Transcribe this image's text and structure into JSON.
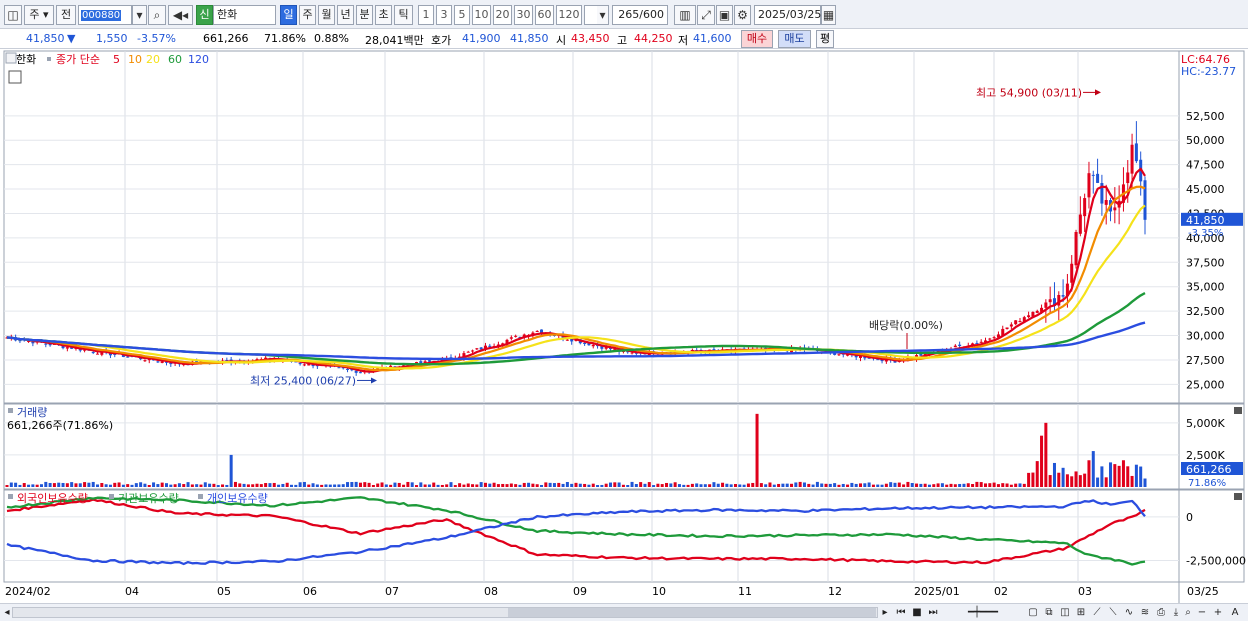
{
  "toolbar": {
    "market": "주",
    "market_alt": "전",
    "stock_code": "000880",
    "badge": "신",
    "stock_name": "한화",
    "periods": [
      "일",
      "주",
      "월",
      "년",
      "분",
      "초",
      "틱"
    ],
    "selected_period": "일",
    "intervals": [
      "1",
      "3",
      "5",
      "10",
      "20",
      "30",
      "60",
      "120"
    ],
    "count": "265",
    "count_total": "/600",
    "date": "2025/03/25"
  },
  "quote": {
    "price": "41,850",
    "direction": "▼",
    "change": "1,550",
    "change_pct": "-3.57%",
    "volume": "661,266",
    "volume_pct": "71.86%",
    "turnover_pct": "0.88%",
    "amount": "28,041백만",
    "ask_label": "호가",
    "ask1": "41,900",
    "ask2": "41,850",
    "open_label": "시",
    "open": "43,450",
    "high_label": "고",
    "high": "44,250",
    "low_label": "저",
    "low": "41,600",
    "buy_label": "매수",
    "sell_label": "매도",
    "avg_label": "평"
  },
  "price_panel": {
    "stock_label": "한화",
    "ma_prefix": "종가 단순",
    "ma_periods": [
      "5",
      "10",
      "20",
      "60",
      "120"
    ],
    "lc_label": "LC:64.76",
    "hc_label": "HC:-23.77",
    "high_annotation": "최고 54,900 (03/11)",
    "low_annotation": "최저 25,400 (06/27)",
    "dividend_annotation": "배당락(0.00%)",
    "current_price_tag": "41,850",
    "current_pct_tag": "-3.35%"
  },
  "volume_panel": {
    "title": "거래량",
    "value_label": "661,266주(71.86%)",
    "tag_value": "661,266",
    "tag_pct": "71.86%"
  },
  "holdings_panel": {
    "series_labels": [
      "외국인보유수량",
      "기관보유수량",
      "개인보유수량"
    ]
  },
  "x_axis": {
    "labels": [
      "2024/02",
      "04",
      "05",
      "06",
      "07",
      "08",
      "09",
      "10",
      "11",
      "12",
      "2025/01",
      "02",
      "03"
    ],
    "end_label": "03/25"
  },
  "colors": {
    "up": "#e0001b",
    "down": "#1f55d6",
    "ma5": "#e0001b",
    "ma10": "#f28c00",
    "ma20": "#f5e21a",
    "ma60": "#1e9a3a",
    "ma120": "#2b4de0",
    "foreign": "#e0001b",
    "institution": "#1e9a3a",
    "individual": "#2b4de0"
  },
  "chart_data": [
    {
      "type": "candlestick",
      "title": "한화",
      "ylim": [
        23500,
        57500
      ],
      "yticks": [
        25000,
        27500,
        30000,
        32500,
        35000,
        37500,
        40000,
        42500,
        45000,
        47500,
        50000,
        52500
      ],
      "high": {
        "value": 54900,
        "date": "03/11"
      },
      "low": {
        "value": 25400,
        "date": "06/27"
      },
      "close": 41850,
      "change_pct": -3.35,
      "anchors": [
        {
          "date": "2024/02",
          "close": 29800
        },
        {
          "date": "03",
          "close": 28400
        },
        {
          "date": "04",
          "close": 27100
        },
        {
          "date": "05",
          "close": 27600
        },
        {
          "date": "06",
          "close": 26300
        },
        {
          "date": "07",
          "close": 27500
        },
        {
          "date": "08",
          "close": 30500
        },
        {
          "date": "09",
          "close": 28200
        },
        {
          "date": "10",
          "close": 28400
        },
        {
          "date": "11",
          "close": 28600
        },
        {
          "date": "12",
          "close": 27400
        },
        {
          "date": "2025/01",
          "close": 29500
        },
        {
          "date": "02/05",
          "close": 34500
        },
        {
          "date": "02/14",
          "close": 46500
        },
        {
          "date": "02/25",
          "close": 42000
        },
        {
          "date": "03/11",
          "close": 49500
        },
        {
          "date": "03/25",
          "close": 41850
        }
      ],
      "moving_averages": [
        "5",
        "10",
        "20",
        "60",
        "120"
      ]
    },
    {
      "type": "bar",
      "title": "거래량",
      "ylim": [
        0,
        6000000
      ],
      "yticks": [
        2500000,
        5000000
      ],
      "ytick_labels": [
        "2,500K",
        "5,000K"
      ],
      "last": 661266,
      "last_pct": 71.86
    },
    {
      "type": "line",
      "title": "외국인보유수량 / 기관보유수량 / 개인보유수량",
      "ylim": [
        -3500000,
        1200000
      ],
      "yticks": [
        0,
        -2500000
      ],
      "ytick_labels": [
        "0",
        "-2,500,000"
      ],
      "series": [
        {
          "name": "외국인보유수량",
          "anchors": [
            0.35,
            1.0,
            0.2,
            0.05,
            -0.95,
            -0.15,
            -2.15,
            -2.35,
            -2.4,
            -2.4,
            -2.55,
            -2.6,
            -1.8,
            -1.1,
            -0.4,
            0.0,
            0.35
          ]
        },
        {
          "name": "기관보유수량",
          "anchors": [
            0.55,
            1.1,
            0.95,
            0.65,
            1.1,
            0.4,
            -0.8,
            -1.0,
            -1.1,
            -1.05,
            -1.0,
            -1.3,
            -1.5,
            -2.2,
            -2.4,
            -2.7,
            -2.5
          ]
        },
        {
          "name": "개인보유수량",
          "anchors": [
            -1.6,
            -2.5,
            -2.65,
            -2.55,
            -2.0,
            -1.2,
            0.0,
            0.3,
            0.4,
            0.35,
            0.5,
            0.55,
            0.6,
            0.95,
            0.7,
            0.9,
            0.05
          ]
        }
      ]
    }
  ]
}
